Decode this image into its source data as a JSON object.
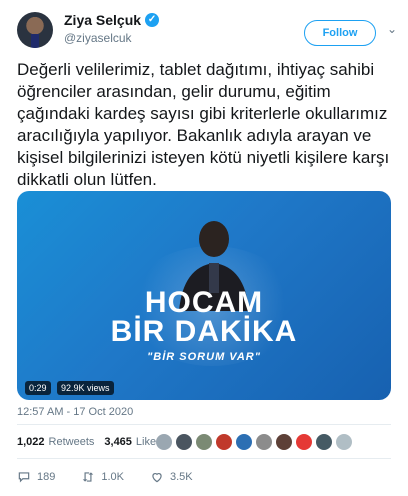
{
  "author": {
    "name": "Ziya Selçuk",
    "handle": "@ziyaselcuk",
    "verified": true
  },
  "follow_label": "Follow",
  "tweet_text": "Değerli velilerimiz, tablet dağıtımı, ihtiyaç sahibi öğrenciler arasından, gelir durumu, eğitim çağındaki kardeş sayısı gibi kriterlerle okullarımız aracılığıyla yapılıyor. Bakanlık adıyla arayan ve kişisel bilgilerinizi isteyen kötü niyetli kişilere karşı dikkatli olun lütfen.",
  "media": {
    "title_line1": "HOCAM",
    "title_line2": "BİR DAKİKA",
    "subtitle": "\"BİR SORUM VAR\"",
    "duration": "0:29",
    "views": "92.9K views",
    "background_color": "#1a8fd6"
  },
  "timestamp": "12:57 AM - 17 Oct 2020",
  "stats": {
    "retweets_count": "1,022",
    "retweets_label": "Retweets",
    "likes_count": "3,465",
    "likes_label": "Likes"
  },
  "likers": [
    "avatar",
    "avatar",
    "avatar",
    "avatar",
    "avatar",
    "avatar",
    "avatar",
    "avatar",
    "avatar",
    "avatar"
  ],
  "actions": {
    "reply_count": "189",
    "retweet_count": "1.0K",
    "like_count": "3.5K"
  },
  "colors": {
    "accent": "#1da1f2",
    "secondary_text": "#657786"
  }
}
